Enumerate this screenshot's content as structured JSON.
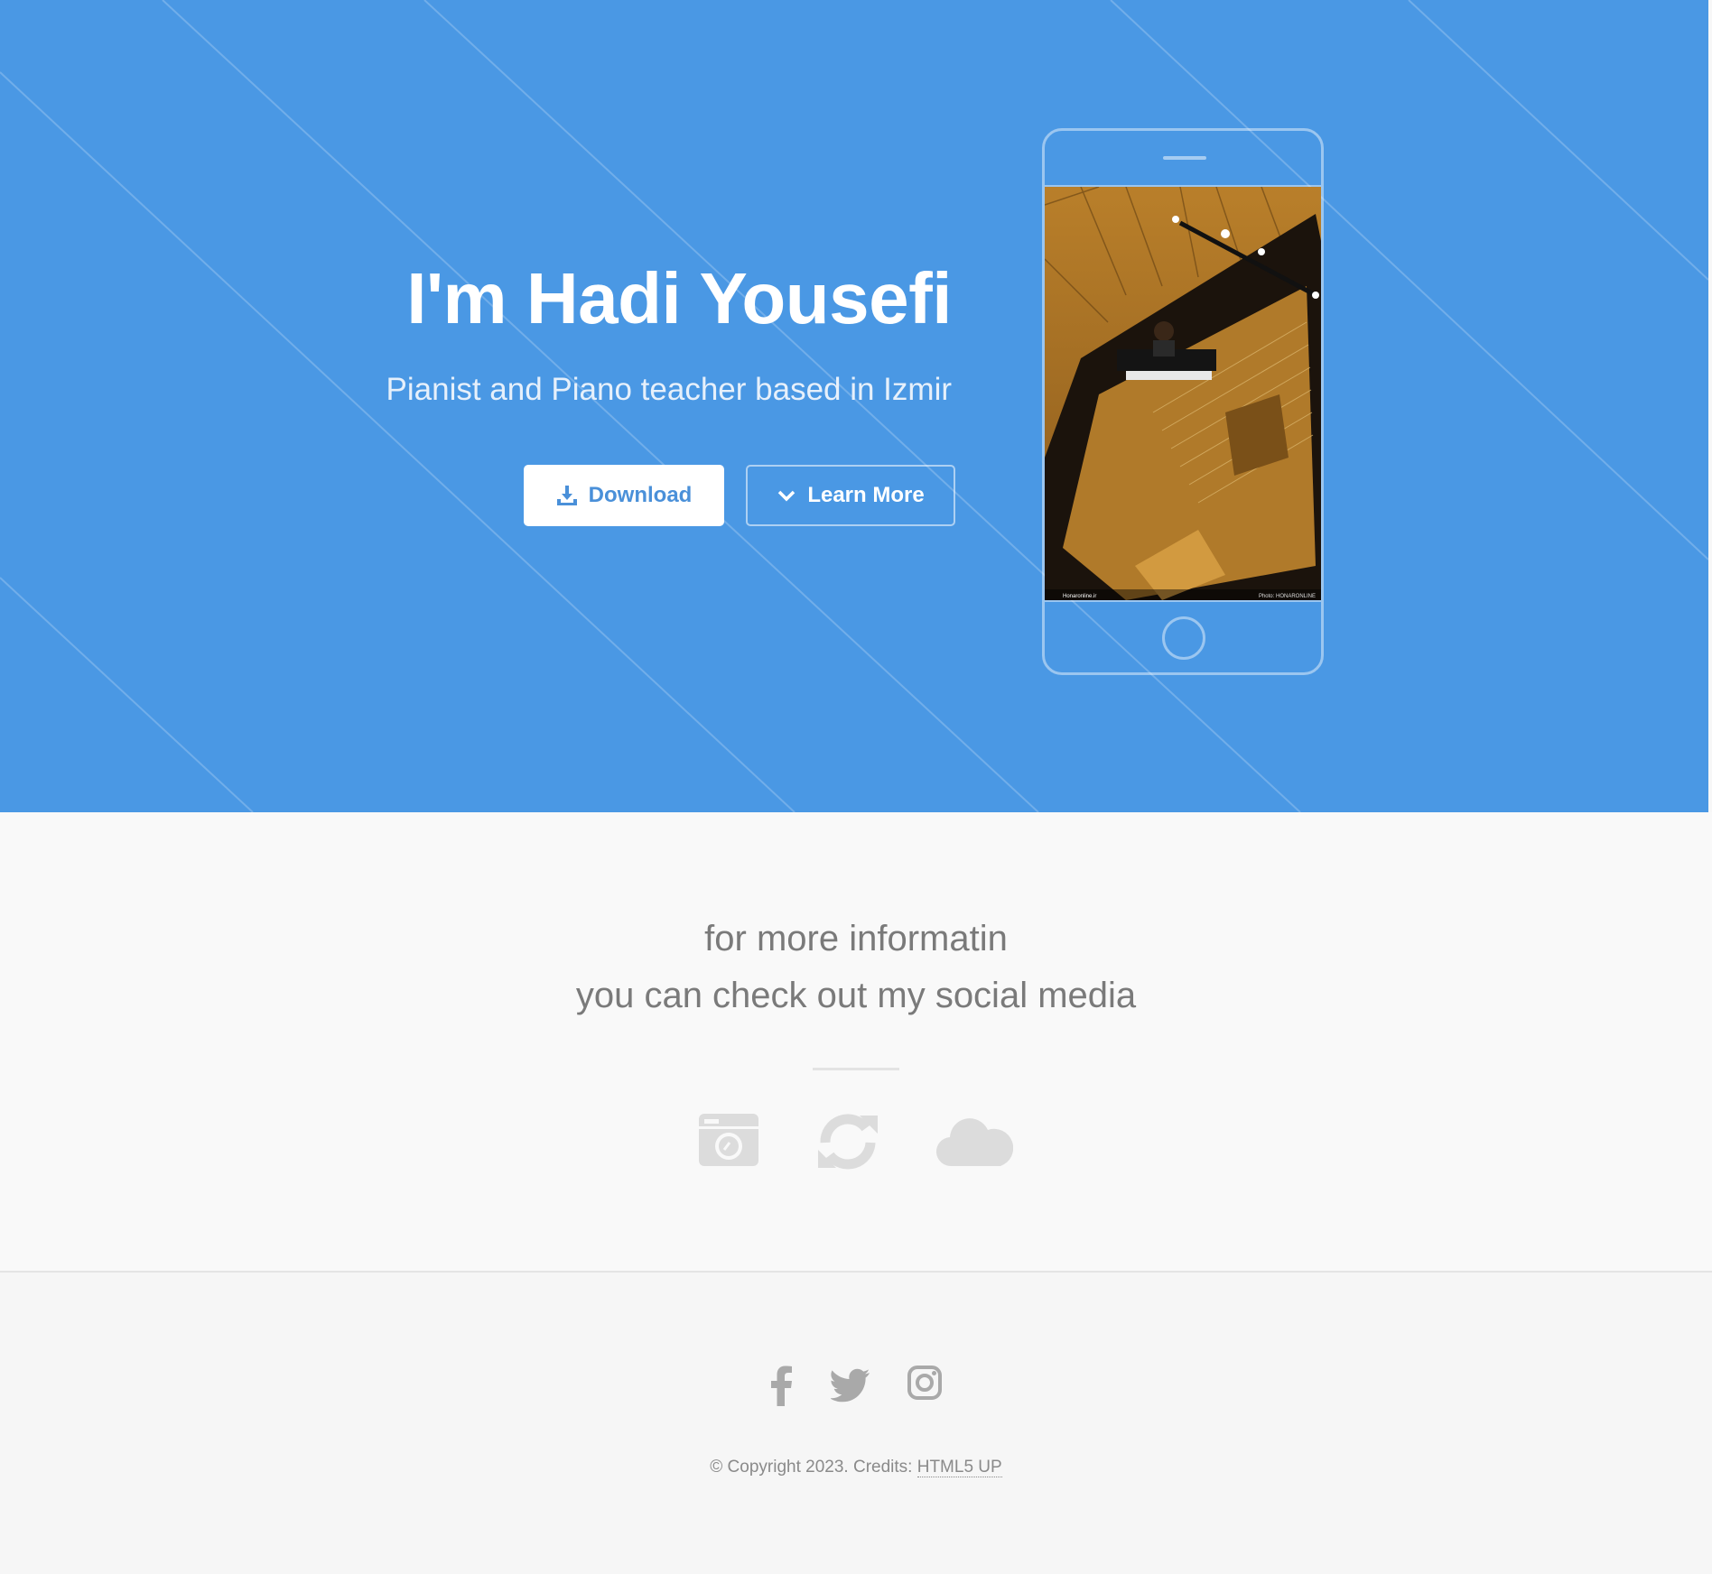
{
  "hero": {
    "title": "I'm Hadi Yousefi",
    "subtitle": "Pianist and Piano teacher based in Izmir",
    "download_label": "Download",
    "learn_more_label": "Learn More",
    "download_icon": "download-icon",
    "learn_more_icon": "chevron-down-icon",
    "photo_caption_left": "Honaronline.ir",
    "photo_caption_right": "Photo: HONARONLINE",
    "background_color": "#4a98e4"
  },
  "info": {
    "line1": "for more informatin",
    "line2": "you can check out my social media",
    "icons": [
      "camera-icon",
      "refresh-icon",
      "cloud-icon"
    ]
  },
  "footer": {
    "social_icons": [
      "facebook-icon",
      "twitter-icon",
      "instagram-icon"
    ],
    "copyright": "© Copyright 2023. Credits: ",
    "credit_link": "HTML5 UP"
  }
}
